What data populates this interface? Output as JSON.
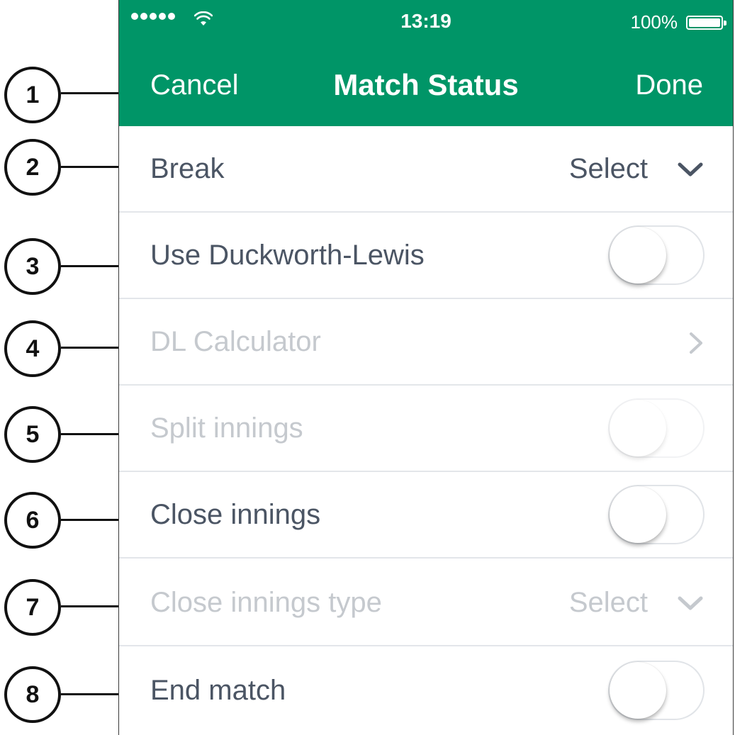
{
  "status_bar": {
    "time": "13:19",
    "battery_percent": "100%",
    "signal_bars": 5
  },
  "nav": {
    "cancel_label": "Cancel",
    "title": "Match Status",
    "done_label": "Done"
  },
  "rows": [
    {
      "label": "Break",
      "value": "Select",
      "control": "dropdown",
      "enabled": true
    },
    {
      "label": "Use Duckworth-Lewis",
      "control": "toggle",
      "on": false,
      "enabled": true
    },
    {
      "label": "DL Calculator",
      "control": "disclosure",
      "enabled": false
    },
    {
      "label": "Split innings",
      "control": "toggle",
      "on": false,
      "enabled": false
    },
    {
      "label": "Close innings",
      "control": "toggle",
      "on": false,
      "enabled": true
    },
    {
      "label": "Close innings type",
      "value": "Select",
      "control": "dropdown",
      "enabled": false
    },
    {
      "label": "End match",
      "control": "toggle",
      "on": false,
      "enabled": true
    }
  ],
  "callouts": [
    "1",
    "2",
    "3",
    "4",
    "5",
    "6",
    "7",
    "8"
  ],
  "colors": {
    "accent": "#009567",
    "text": "#4b5564",
    "disabled_text": "#c5c9ce",
    "divider": "#e3e6ea"
  },
  "icons": {
    "wifi": "wifi-icon",
    "battery": "battery-icon",
    "dropdown": "chevron-down-icon",
    "disclosure": "chevron-right-icon"
  }
}
